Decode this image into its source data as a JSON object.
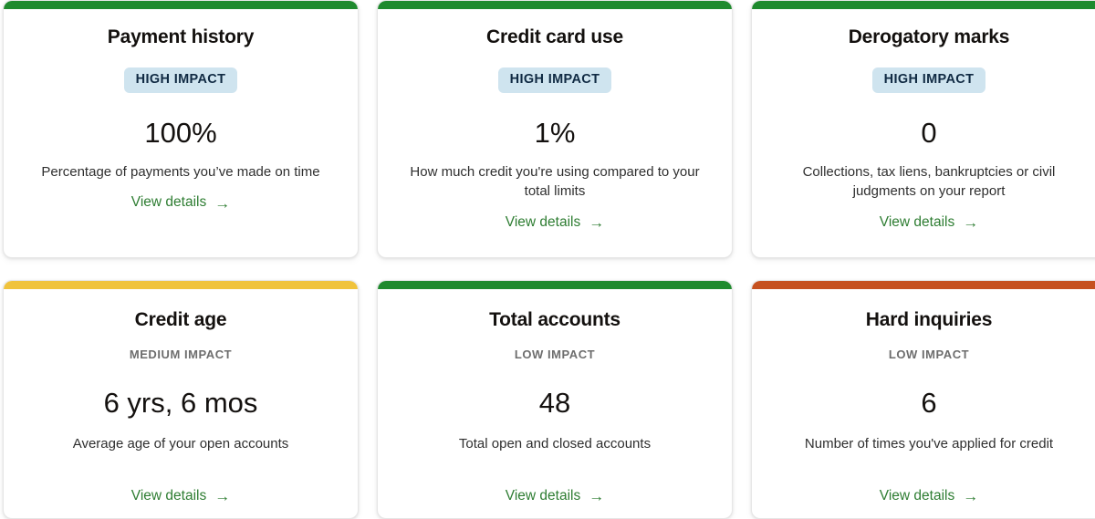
{
  "grid": {
    "accent_colors": {
      "good": "#1f8a2e",
      "fair": "#f0c33c",
      "poor": "#c6511f"
    },
    "badge": {
      "background": "#cfe4ef",
      "text_color": "#102a43"
    },
    "link_color": "#2e7d32",
    "link_arrow_icon": "→",
    "cards": [
      {
        "title": "Payment history",
        "impact": "HIGH IMPACT",
        "impact_style": "badge",
        "value": "100%",
        "description": "Percentage of payments you’ve made on time",
        "link_label": "View details",
        "accent": "#1f8a2e"
      },
      {
        "title": "Credit card use",
        "impact": "HIGH IMPACT",
        "impact_style": "badge",
        "value": "1%",
        "description": "How much credit you're using compared to your total limits",
        "link_label": "View details",
        "accent": "#1f8a2e"
      },
      {
        "title": "Derogatory marks",
        "impact": "HIGH IMPACT",
        "impact_style": "badge",
        "value": "0",
        "description": "Collections, tax liens, bankruptcies or civil judgments on your report",
        "link_label": "View details",
        "accent": "#1f8a2e"
      },
      {
        "title": "Credit age",
        "impact": "MEDIUM IMPACT",
        "impact_style": "plain",
        "value": "6 yrs, 6 mos",
        "description": "Average age of your open accounts",
        "link_label": "View details",
        "accent": "#f0c33c"
      },
      {
        "title": "Total accounts",
        "impact": "LOW IMPACT",
        "impact_style": "plain",
        "value": "48",
        "description": "Total open and closed accounts",
        "link_label": "View details",
        "accent": "#1f8a2e"
      },
      {
        "title": "Hard inquiries",
        "impact": "LOW IMPACT",
        "impact_style": "plain",
        "value": "6",
        "description": "Number of times you've applied for credit",
        "link_label": "View details",
        "accent": "#c6511f"
      }
    ]
  }
}
